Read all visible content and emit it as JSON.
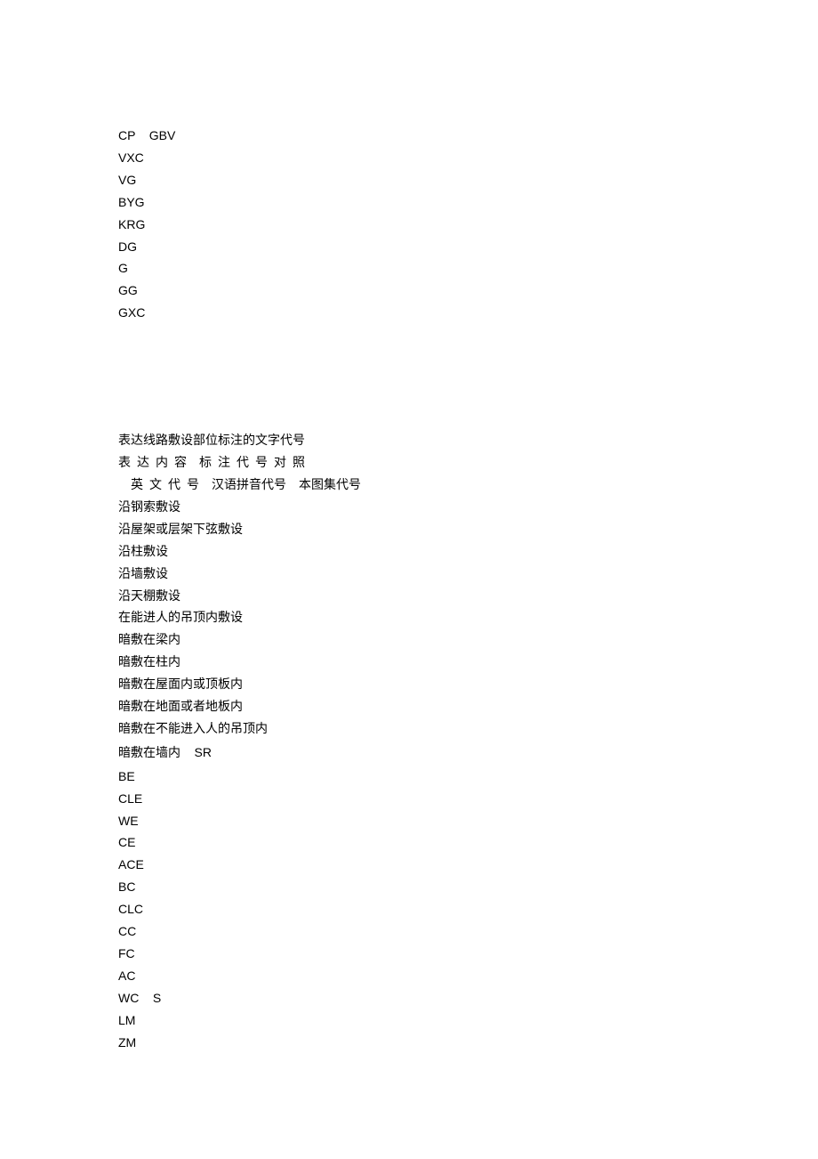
{
  "section1": [
    {
      "text": "CP    GBV",
      "arial": true
    },
    {
      "text": "VXC",
      "arial": true
    },
    {
      "text": "VG",
      "arial": true
    },
    {
      "text": "BYG",
      "arial": true
    },
    {
      "text": "KRG",
      "arial": true
    },
    {
      "text": "DG",
      "arial": true
    },
    {
      "text": "G",
      "arial": true
    },
    {
      "text": "GG",
      "arial": true
    },
    {
      "text": "GXC",
      "arial": true
    }
  ],
  "section2": [
    {
      "text": "表达线路敷设部位标注的文字代号"
    },
    {
      "text": "表  达  内  容    标  注  代  号  对  照"
    },
    {
      "text": "    英  文  代  号    汉语拼音代号    本图集代号"
    },
    {
      "text": "沿钢索敷设"
    },
    {
      "text": "沿屋架或层架下弦敷设"
    },
    {
      "text": "沿柱敷设"
    },
    {
      "text": "沿墙敷设"
    },
    {
      "text": "沿天棚敷设"
    },
    {
      "text": "在能进人的吊顶内敷设"
    },
    {
      "text": "暗敷在梁内"
    },
    {
      "text": "暗敷在柱内"
    },
    {
      "text": "暗敷在屋面内或顶板内"
    },
    {
      "text": "暗敷在地面或者地板内"
    },
    {
      "text": "暗敷在不能进入人的吊顶内"
    },
    {
      "text": "暗敷在墙内    SR",
      "mixed": true
    },
    {
      "text": "BE",
      "arial": true
    },
    {
      "text": "CLE",
      "arial": true
    },
    {
      "text": "WE",
      "arial": true
    },
    {
      "text": "CE",
      "arial": true
    },
    {
      "text": "ACE",
      "arial": true
    },
    {
      "text": "BC",
      "arial": true
    },
    {
      "text": "CLC",
      "arial": true
    },
    {
      "text": "CC",
      "arial": true
    },
    {
      "text": "FC",
      "arial": true
    },
    {
      "text": "AC",
      "arial": true
    },
    {
      "text": "WC    S",
      "arial": true
    },
    {
      "text": "LM",
      "arial": true
    },
    {
      "text": "ZM",
      "arial": true
    }
  ]
}
